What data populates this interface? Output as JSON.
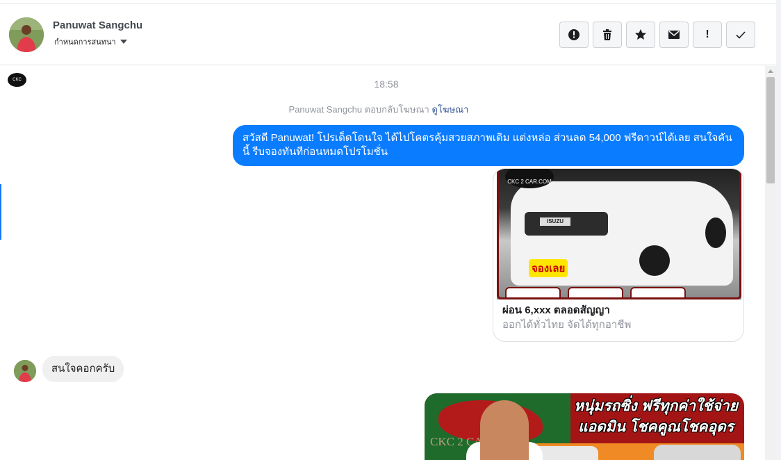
{
  "header": {
    "contact_name": "Panuwat Sangchu",
    "contact_subtitle": "กำหนดการสนทนา",
    "actions": [
      {
        "name": "report-button",
        "icon": "alert-circle-icon"
      },
      {
        "name": "delete-button",
        "icon": "trash-icon"
      },
      {
        "name": "star-button",
        "icon": "star-icon"
      },
      {
        "name": "mark-unread-button",
        "icon": "envelope-icon"
      },
      {
        "name": "mark-important-button",
        "icon": "exclamation-icon",
        "glyph": "!"
      },
      {
        "name": "mark-done-button",
        "icon": "checkmark-icon"
      }
    ]
  },
  "conversation": {
    "timestamp": "18:58",
    "ad_reply_text": "Panuwat Sangchu ตอบกลับโฆษณา",
    "ad_reply_link": "ดูโฆษณา",
    "outgoing_message": "สวัสดี Panuwat! โปรเด็ดโดนใจ ได้ไปโคตรคุ้มสวยสภาพเดิม แต่งหล่อ  ส่วนลด 54,000 ฟรีดาวน์ได้เลย  สนใจคันนี้ รีบจองทันทีก่อนหมดโปรโมชั่น",
    "ad_card": {
      "logo_text": "CKC 2 CAR.COM",
      "badge_text": "ISUZU",
      "book_tag": "จองเลย",
      "title": "ผ่อน 6,xxx ตลอดสัญญา",
      "subtitle": "ออกได้ทั่วไทย จัดได้ทุกอาชีพ"
    },
    "incoming_message": "สนใจคอกครับ",
    "banner": {
      "brand_text": "CKC 2 CAR.COM",
      "headline_line1": "หนุ่มรถซิ่ง ฟรีทุกค่าใช้จ่าย",
      "headline_line2": "แอดมิน โชคคูณโชคอุดร"
    }
  },
  "colors": {
    "outgoing_bubble": "#0a7cff",
    "incoming_bubble": "#f1f0f0",
    "link": "#385898",
    "muted_text": "#90949c"
  }
}
